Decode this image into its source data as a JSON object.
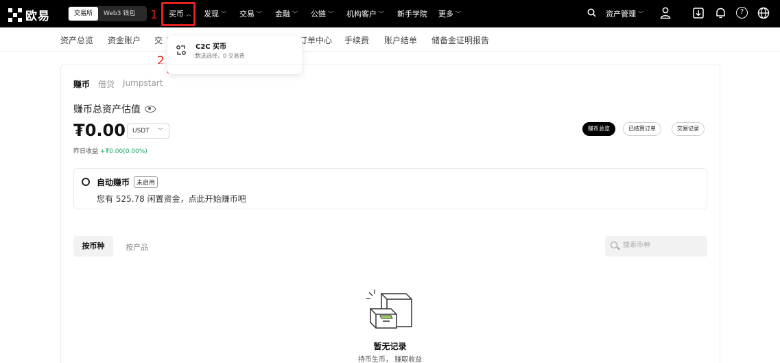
{
  "topbar": {
    "logo_text": "欧易",
    "switch": [
      "交易所",
      "Web3 钱包"
    ],
    "nav": [
      "买币",
      "发现",
      "交易",
      "金融",
      "公链",
      "机构客户",
      "新手学院",
      "更多"
    ],
    "asset_mgmt": "资产管理"
  },
  "annotations": [
    "1",
    "2"
  ],
  "subnav": [
    "资产总览",
    "资金账户",
    "交",
    "订单中心",
    "手续费",
    "账户结单",
    "储备金证明报告"
  ],
  "dropdown": {
    "title": "C2C 买币",
    "subtitle": "优选选择，0 交易费"
  },
  "earn": {
    "tabs": [
      "赚币",
      "借贷",
      "Jumpstart"
    ],
    "estimate_label": "赚币总资产估值",
    "balance": "₮0.00",
    "currency": "USDT",
    "yesterday_label": "昨日收益",
    "yesterday_value": "+₮0.00(0.00%)",
    "pills": [
      "赚币总览",
      "已结算订单",
      "交易记录"
    ]
  },
  "auto_earn": {
    "title": "自动赚币",
    "badge": "未启用",
    "desc": "您有 525.78 闲置资金，点此开始赚币吧"
  },
  "list": {
    "tabs": [
      "按币种",
      "按产品"
    ],
    "search_placeholder": "搜索币种"
  },
  "empty": {
    "title": "暂无记录",
    "subtitle": "持币生币， 赚取收益"
  },
  "colors": {
    "annotation": "#e8201c",
    "positive": "#1aa367",
    "topbar": "#000000"
  }
}
